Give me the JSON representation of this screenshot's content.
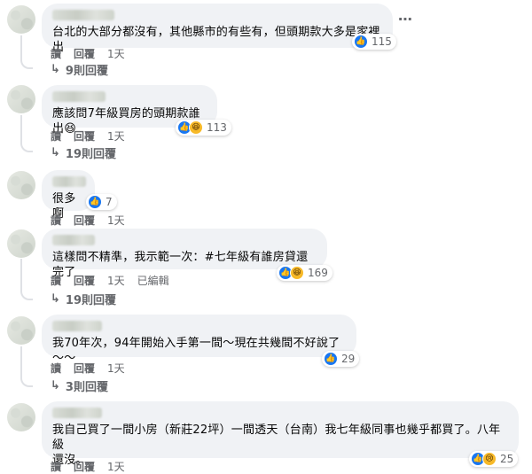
{
  "actions": {
    "read": "讀",
    "reply": "回覆"
  },
  "more_icon": "⋯",
  "comments": [
    {
      "text": "台北的大部分都沒有，其他縣市的有些有，但頭期款大多是家裡出",
      "reaction_count": "115",
      "reactions": [
        "like"
      ],
      "time": "1天",
      "replies": "9則回覆"
    },
    {
      "text": "應該問7年級買房的頭期款誰出",
      "emoji": "😆",
      "reaction_count": "113",
      "reactions": [
        "like",
        "haha"
      ],
      "time": "1天",
      "replies": "19則回覆"
    },
    {
      "text": "很多啊",
      "reaction_count": "7",
      "reactions": [
        "like"
      ],
      "time": "1天"
    },
    {
      "text": "這樣問不精準，我示範一次：#七年級有誰房貸還完了",
      "reaction_count": "169",
      "reactions": [
        "like",
        "haha"
      ],
      "time": "1天",
      "edited": "已編輯",
      "replies": "19則回覆"
    },
    {
      "text": "我70年次，94年開始入手第一間～現在共幾間不好說了～～",
      "reaction_count": "29",
      "reactions": [
        "like"
      ],
      "time": "1天",
      "replies": "3則回覆"
    },
    {
      "text_line1": "我自己買了一間小房（新莊22坪）一間透天（台南）我七年級同事也幾乎都買了。八年級",
      "text_line2": "還沒。",
      "reaction_count": "25",
      "reactions": [
        "like",
        "sad"
      ],
      "time": "1天"
    }
  ]
}
